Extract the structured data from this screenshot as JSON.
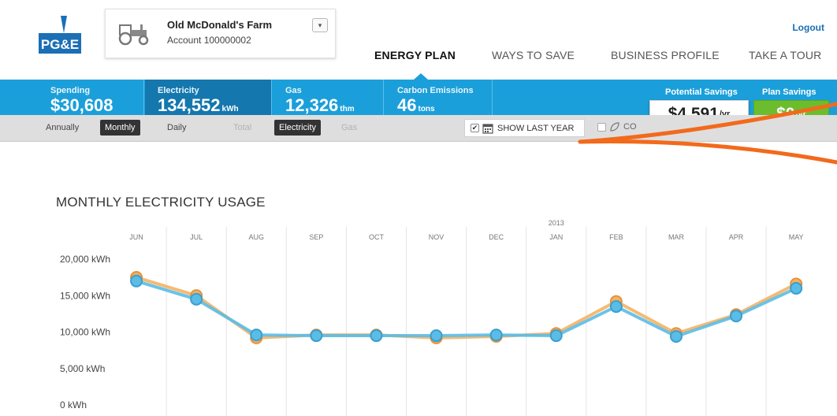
{
  "brand": {
    "logo_text": "PG&E"
  },
  "account": {
    "name": "Old McDonald's Farm",
    "number": "Account 100000002",
    "dropdown_glyph": "▾",
    "icon": "tractor-icon"
  },
  "header": {
    "logout": "Logout"
  },
  "nav": {
    "tabs": [
      {
        "label": "ENERGY PLAN",
        "active": true
      },
      {
        "label": "WAYS TO SAVE"
      },
      {
        "label": "BUSINESS PROFILE"
      },
      {
        "label": "TAKE A TOUR"
      }
    ]
  },
  "stats": {
    "spending": {
      "label": "Spending",
      "value": "$30,608",
      "unit": ""
    },
    "electricity": {
      "label": "Electricity",
      "value": "134,552",
      "unit": "kWh"
    },
    "gas": {
      "label": "Gas",
      "value": "12,326",
      "unit": "thm"
    },
    "carbon": {
      "label": "Carbon Emissions",
      "value": "46",
      "unit": "tons"
    }
  },
  "savings": {
    "potential_label": "Potential Savings",
    "potential_value": "$4,591",
    "plan_label": "Plan Savings",
    "plan_value": "$0",
    "per": "/yr"
  },
  "filters": {
    "annually": "Annually",
    "monthly": "Monthly",
    "daily": "Daily",
    "total": "Total",
    "electricity": "Electricity",
    "gas": "Gas",
    "show_last_year": "SHOW LAST YEAR",
    "show_last_year_checked": true,
    "compare_partial": "CO"
  },
  "colors": {
    "accent": "#1b9fda",
    "selected": "#1477ae",
    "this_year": "#5bbde6",
    "last_year": "#f4b264",
    "plan_green": "#6cbd2d",
    "annotation": "#f26a1b"
  },
  "chart_data": {
    "type": "line",
    "title": "MONTHLY ELECTRICITY USAGE",
    "year_marker": {
      "label": "2013",
      "at": "JAN"
    },
    "categories": [
      "JUN",
      "JUL",
      "AUG",
      "SEP",
      "OCT",
      "NOV",
      "DEC",
      "JAN",
      "FEB",
      "MAR",
      "APR",
      "MAY"
    ],
    "y_ticks": [
      "20,000 kWh",
      "15,000 kWh",
      "10,000 kWh",
      "5,000 kWh",
      "0 kWh"
    ],
    "ylim": [
      0,
      20000
    ],
    "grid": true,
    "series": [
      {
        "values": [
          17400,
          14900,
          9100,
          9500,
          9500,
          9100,
          9300,
          9700,
          14100,
          9700,
          12300,
          16500
        ]
      },
      {
        "values": [
          16900,
          14400,
          9500,
          9400,
          9400,
          9400,
          9500,
          9400,
          13400,
          9300,
          12100,
          15900
        ]
      }
    ]
  }
}
